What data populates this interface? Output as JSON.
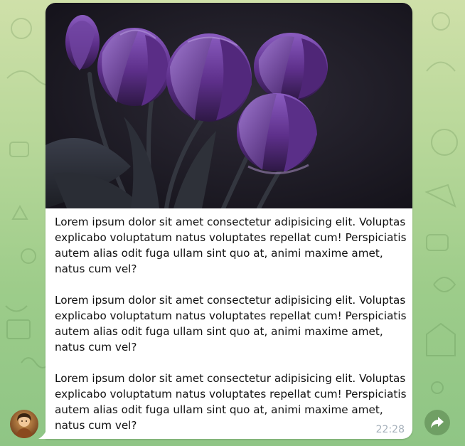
{
  "message": {
    "paragraphs": [
      "Lorem ipsum dolor sit amet consectetur adipisicing elit. Voluptas explicabo voluptatum natus voluptates repellat cum! Perspiciatis autem alias odit fuga ullam sint quo at, animi maxime amet, natus cum vel?",
      "Lorem ipsum dolor sit amet consectetur adipisicing elit. Voluptas explicabo voluptatum natus voluptates repellat cum! Perspiciatis autem alias odit fuga ullam sint quo at, animi maxime amet, natus cum vel?",
      "Lorem ipsum dolor sit amet consectetur adipisicing elit. Voluptas explicabo voluptatum natus voluptates repellat cum! Perspiciatis autem alias odit fuga ullam sint quo at, animi maxime amet, natus cum vel?"
    ],
    "time": "22:28",
    "photo_subject": "purple tulips on dark background"
  },
  "icons": {
    "share": "share-arrow-icon",
    "avatar": "user-avatar"
  },
  "colors": {
    "bubble": "#ffffff",
    "time": "#a5b0ba",
    "share_button": "#6f9a5f",
    "photo_bg": "#24212c",
    "tulip": "#6b3c97"
  }
}
